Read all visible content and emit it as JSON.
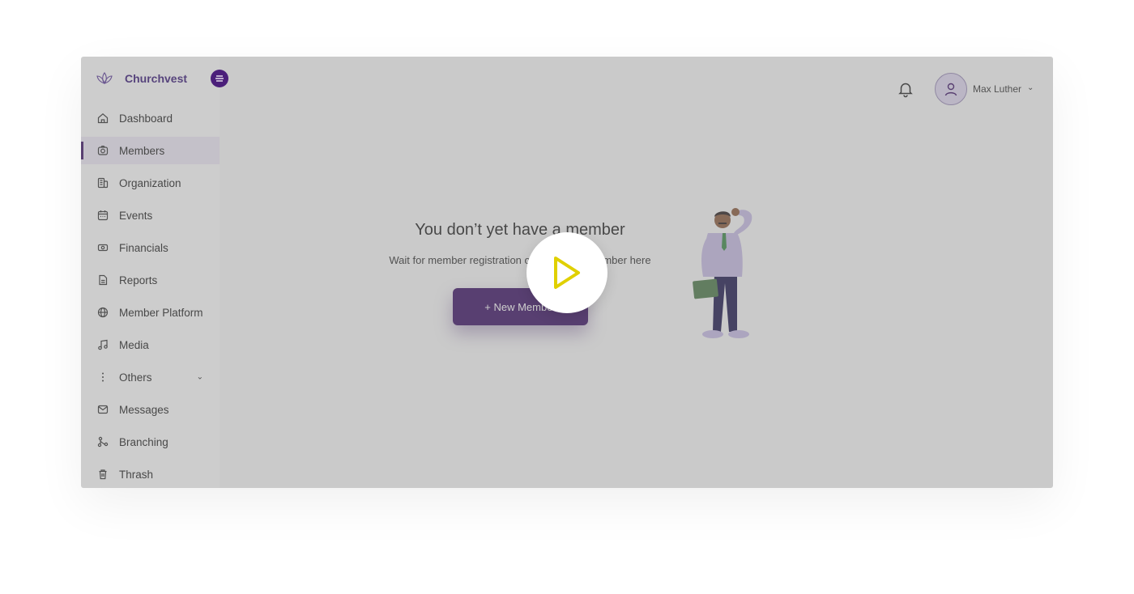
{
  "app": {
    "brand_name": "Churchvest"
  },
  "sidebar": {
    "items": [
      {
        "label": "Dashboard",
        "icon": "home-icon",
        "active": false
      },
      {
        "label": "Members",
        "icon": "camera-icon",
        "active": true
      },
      {
        "label": "Organization",
        "icon": "building-icon",
        "active": false
      },
      {
        "label": "Events",
        "icon": "calendar-icon",
        "active": false
      },
      {
        "label": "Financials",
        "icon": "money-icon",
        "active": false
      },
      {
        "label": "Reports",
        "icon": "document-icon",
        "active": false
      },
      {
        "label": "Member Platform",
        "icon": "globe-icon",
        "active": false
      },
      {
        "label": "Media",
        "icon": "music-icon",
        "active": false
      },
      {
        "label": "Others",
        "icon": "more-vertical-icon",
        "active": false,
        "has_caret": true
      },
      {
        "label": "Messages",
        "icon": "mail-icon",
        "active": false
      },
      {
        "label": "Branching",
        "icon": "branch-icon",
        "active": false
      },
      {
        "label": "Thrash",
        "icon": "trash-icon",
        "active": false
      }
    ]
  },
  "header": {
    "user_name": "Max Luther"
  },
  "empty_state": {
    "title": "You don’t yet have a member",
    "subtitle": "Wait for member registration or add a new member here",
    "button_label": "+ New Member"
  },
  "colors": {
    "brand": "#3d1366",
    "accent": "#4b1f7a",
    "play_icon": "#e0d000",
    "active_bg": "#f0ecf8"
  }
}
